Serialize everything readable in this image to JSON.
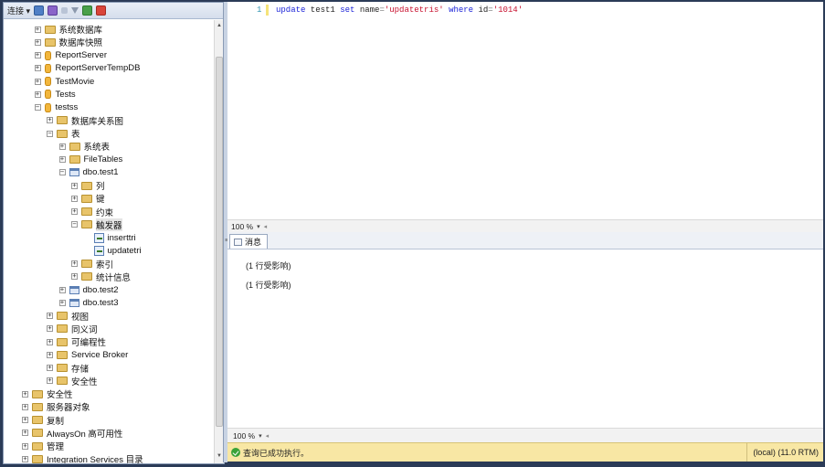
{
  "explorer": {
    "toolbar": {
      "connect_label": "连接 ▾"
    },
    "tree": [
      {
        "label": "系统数据库",
        "indent": 1,
        "icon": "folder",
        "expander": "+"
      },
      {
        "label": "数据库快照",
        "indent": 1,
        "icon": "folder",
        "expander": "+"
      },
      {
        "label": "ReportServer",
        "indent": 1,
        "icon": "database",
        "expander": "+"
      },
      {
        "label": "ReportServerTempDB",
        "indent": 1,
        "icon": "database",
        "expander": "+"
      },
      {
        "label": "TestMovie",
        "indent": 1,
        "icon": "database",
        "expander": "+"
      },
      {
        "label": "Tests",
        "indent": 1,
        "icon": "database",
        "expander": "+"
      },
      {
        "label": "testss",
        "indent": 1,
        "icon": "database",
        "expander": "−"
      },
      {
        "label": "数据库关系图",
        "indent": 2,
        "icon": "folder",
        "expander": "+"
      },
      {
        "label": "表",
        "indent": 2,
        "icon": "folder",
        "expander": "−"
      },
      {
        "label": "系统表",
        "indent": 3,
        "icon": "folder",
        "expander": "+"
      },
      {
        "label": "FileTables",
        "indent": 3,
        "icon": "folder",
        "expander": "+"
      },
      {
        "label": "dbo.test1",
        "indent": 3,
        "icon": "table",
        "expander": "−"
      },
      {
        "label": "列",
        "indent": 4,
        "icon": "folder",
        "expander": "+"
      },
      {
        "label": "键",
        "indent": 4,
        "icon": "folder",
        "expander": "+"
      },
      {
        "label": "约束",
        "indent": 4,
        "icon": "folder",
        "expander": "+"
      },
      {
        "label": "触发器",
        "indent": 4,
        "icon": "folder",
        "expander": "−",
        "selected": true
      },
      {
        "label": "inserttri",
        "indent": 5,
        "icon": "trigger",
        "expander": ""
      },
      {
        "label": "updatetri",
        "indent": 5,
        "icon": "trigger",
        "expander": ""
      },
      {
        "label": "索引",
        "indent": 4,
        "icon": "folder",
        "expander": "+"
      },
      {
        "label": "统计信息",
        "indent": 4,
        "icon": "folder",
        "expander": "+"
      },
      {
        "label": "dbo.test2",
        "indent": 3,
        "icon": "table",
        "expander": "+"
      },
      {
        "label": "dbo.test3",
        "indent": 3,
        "icon": "table",
        "expander": "+"
      },
      {
        "label": "视图",
        "indent": 2,
        "icon": "folder",
        "expander": "+"
      },
      {
        "label": "同义词",
        "indent": 2,
        "icon": "folder",
        "expander": "+"
      },
      {
        "label": "可编程性",
        "indent": 2,
        "icon": "folder",
        "expander": "+"
      },
      {
        "label": "Service Broker",
        "indent": 2,
        "icon": "folder",
        "expander": "+"
      },
      {
        "label": "存储",
        "indent": 2,
        "icon": "folder",
        "expander": "+"
      },
      {
        "label": "安全性",
        "indent": 2,
        "icon": "folder",
        "expander": "+"
      },
      {
        "label": "安全性",
        "indent": 0,
        "icon": "folder",
        "expander": "+"
      },
      {
        "label": "服务器对象",
        "indent": 0,
        "icon": "folder",
        "expander": "+"
      },
      {
        "label": "复制",
        "indent": 0,
        "icon": "folder",
        "expander": "+"
      },
      {
        "label": "AlwaysOn 高可用性",
        "indent": 0,
        "icon": "folder",
        "expander": "+"
      },
      {
        "label": "管理",
        "indent": 0,
        "icon": "folder",
        "expander": "+"
      },
      {
        "label": "Integration Services 目录",
        "indent": 0,
        "icon": "folder",
        "expander": "+"
      }
    ]
  },
  "editor": {
    "line_number": "1",
    "tokens": [
      {
        "text": "update",
        "kind": "kw"
      },
      {
        "text": " test1 ",
        "kind": "plain"
      },
      {
        "text": "set",
        "kind": "kw"
      },
      {
        "text": " name",
        "kind": "plain"
      },
      {
        "text": "=",
        "kind": "op"
      },
      {
        "text": "'updatetris'",
        "kind": "str"
      },
      {
        "text": " ",
        "kind": "plain"
      },
      {
        "text": "where",
        "kind": "kw"
      },
      {
        "text": " id",
        "kind": "plain"
      },
      {
        "text": "=",
        "kind": "op"
      },
      {
        "text": "'1014'",
        "kind": "str"
      }
    ],
    "zoom": "100 %"
  },
  "results": {
    "tab_label": "消息",
    "messages": [
      "(1 行受影响)",
      "(1 行受影响)"
    ],
    "zoom": "100 %"
  },
  "status": {
    "text": "查询已成功执行。",
    "server": "(local) (11.0 RTM)"
  },
  "colors": {
    "keyword": "#1a22d8",
    "string": "#c8102e",
    "status_bar": "#f8e7a4",
    "frame": "#2b3b57"
  }
}
